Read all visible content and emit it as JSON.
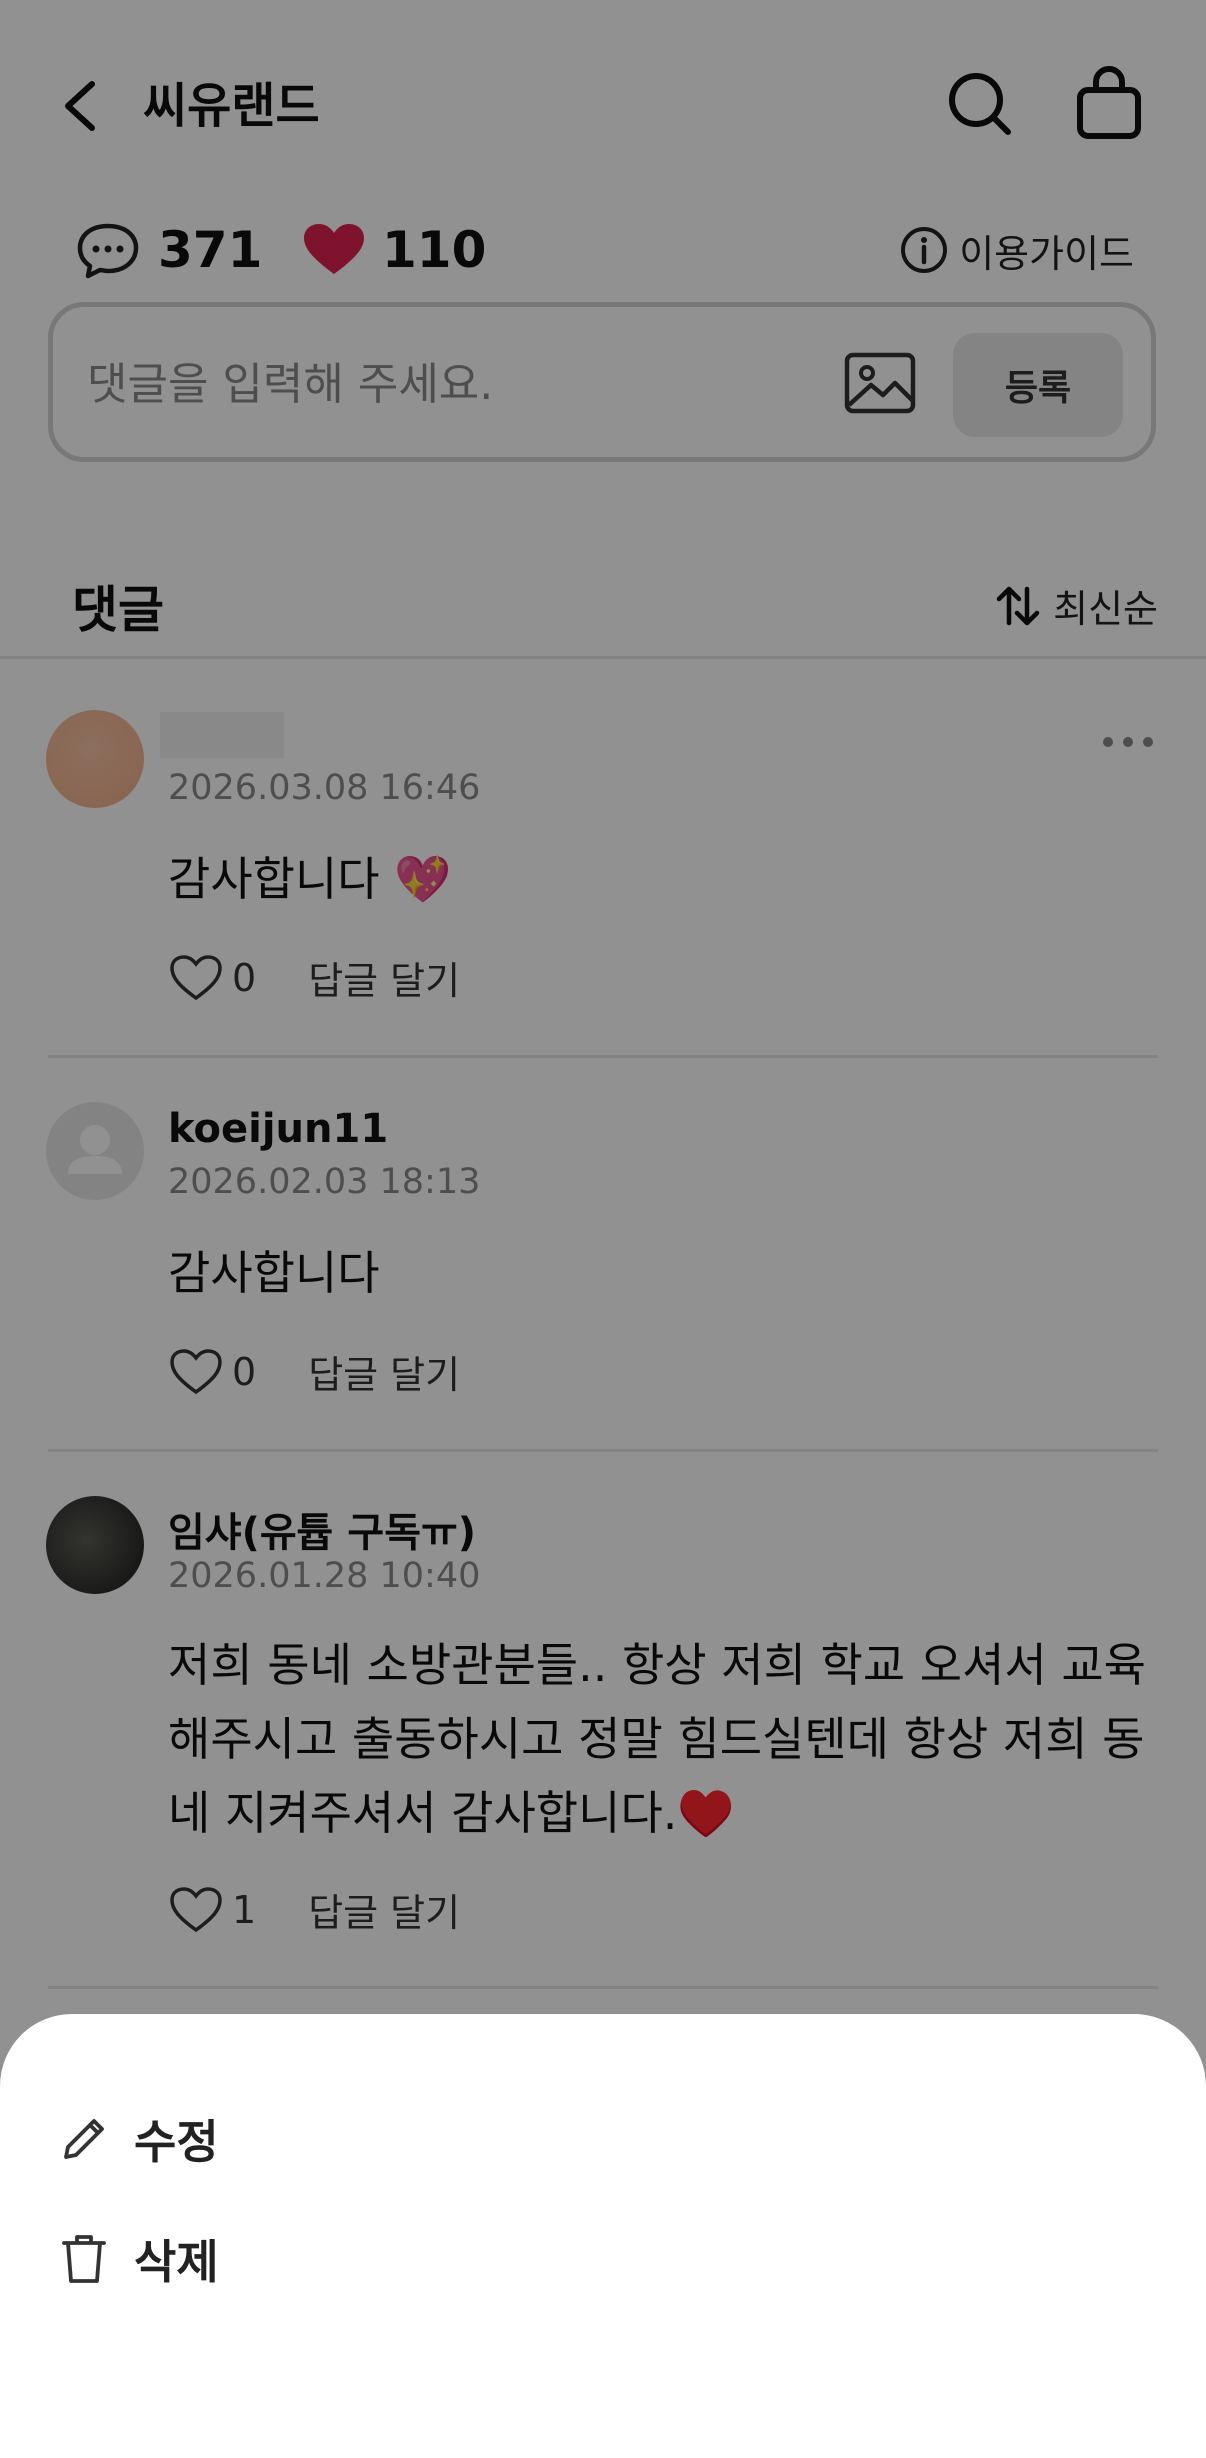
{
  "header": {
    "title": "씨유랜드"
  },
  "stats": {
    "comment_count": "371",
    "like_count": "110",
    "guide_label": "이용가이드"
  },
  "comment_input": {
    "placeholder": "댓글을 입력해 주세요.",
    "submit_label": "등록"
  },
  "comments_section": {
    "title": "댓글",
    "sort_label": "최신순"
  },
  "comments": [
    {
      "name": "",
      "date": "2026.03.08 16:46",
      "text": "감사합니다 💖",
      "likes": "0",
      "reply_label": "답글 달기"
    },
    {
      "name": "koeijun11",
      "date": "2026.02.03 18:13",
      "text": "감사합니다",
      "likes": "0",
      "reply_label": "답글 달기"
    },
    {
      "name": "임샤(유튭 구독ㅠ)",
      "date": "2026.01.28 10:40",
      "text": "저희 동네 소방관분들.. 항상 저희 학교 오셔서 교육해주시고 출동하시고 정말 힘드실텐데 항상 저희 동네 지켜주셔서 감사합니다.♥️",
      "likes": "1",
      "reply_label": "답글 달기"
    }
  ],
  "action_sheet": {
    "edit_label": "수정",
    "delete_label": "삭제"
  },
  "colors": {
    "heart": "#e02352",
    "dim_overlay": "rgba(0,0,0,0.43)"
  }
}
